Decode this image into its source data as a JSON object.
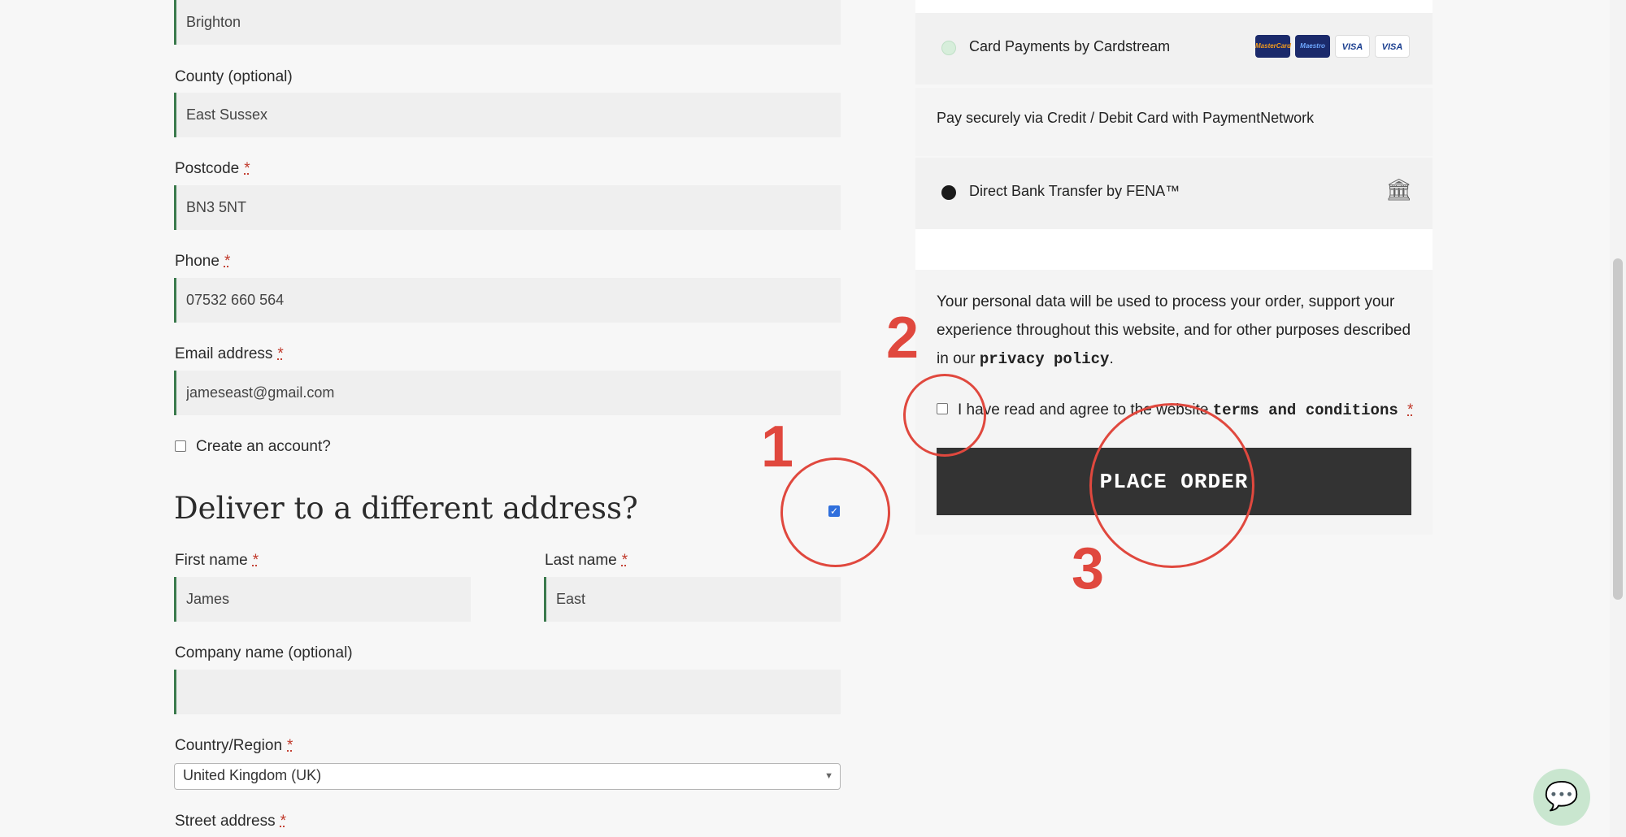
{
  "billing": {
    "city_value": "Brighton",
    "county_label": "County (optional)",
    "county_value": "East Sussex",
    "postcode_label": "Postcode",
    "postcode_value": "BN3 5NT",
    "phone_label": "Phone",
    "phone_value": "07532 660 564",
    "email_label": "Email address",
    "email_value": "jameseast@gmail.com",
    "create_account_label": "Create an account?",
    "required_mark": "*"
  },
  "shipping": {
    "heading": "Deliver to a different address?",
    "first_name_label": "First name",
    "first_name_value": "James",
    "last_name_label": "Last name",
    "last_name_value": "East",
    "company_label": "Company name (optional)",
    "company_value": "",
    "country_label": "Country/Region",
    "country_value": "United Kingdom (UK)",
    "street_label": "Street address"
  },
  "payment": {
    "card_method": "Card Payments by Cardstream",
    "card_description": "Pay securely via Credit / Debit Card with PaymentNetwork",
    "bank_method": "Direct Bank Transfer by FENA™",
    "card_brands": [
      "mastercard-icon",
      "maestro-icon",
      "visa-icon",
      "visa-debit-icon"
    ],
    "brand_labels": [
      "MasterCard",
      "Maestro",
      "VISA",
      "VISA"
    ]
  },
  "privacy": {
    "text": "Your personal data will be used to process your order, support your experience throughout this website, and for other purposes described in our",
    "link": "privacy policy",
    "end": "."
  },
  "terms": {
    "text": "I have read and agree to the website",
    "link": "terms and conditions",
    "required_mark": "*"
  },
  "place_order_label": "PLACE ORDER",
  "annotations": [
    "1",
    "2",
    "3"
  ],
  "colors": {
    "accent_green": "#3b7a4d",
    "annotation_red": "#e0483e",
    "button_dark": "#333333",
    "checkbox_blue": "#2f6fdc"
  }
}
